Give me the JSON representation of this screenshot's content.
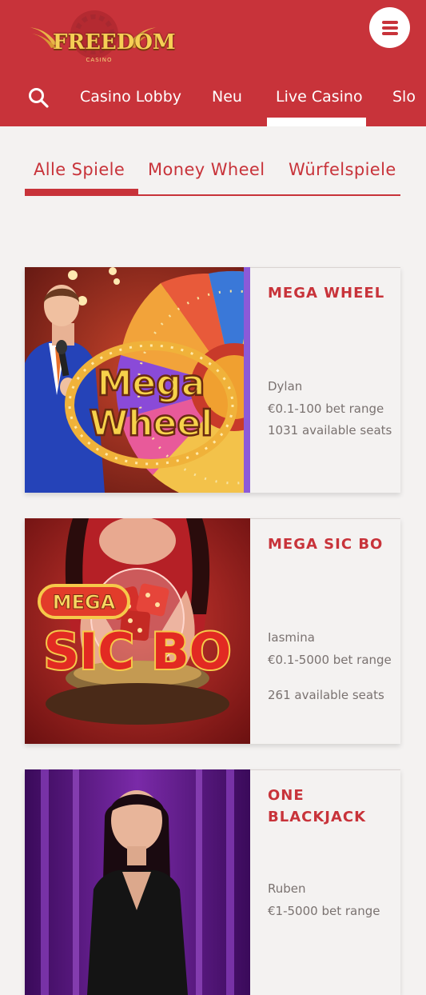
{
  "header": {
    "logo_text": "FREEDOM",
    "logo_sub": "CASINO",
    "menu_icon": "hamburger-icon"
  },
  "nav": {
    "search_icon": "search-icon",
    "items": [
      {
        "label": "Casino Lobby"
      },
      {
        "label": "Neu"
      },
      {
        "label": "Live Casino"
      },
      {
        "label": "Slo"
      }
    ],
    "active": "Live Casino"
  },
  "subtabs": {
    "items": [
      {
        "label": "Alle Spiele"
      },
      {
        "label": "Money Wheel"
      },
      {
        "label": "Würfelspiele"
      }
    ],
    "active": "Alle Spiele"
  },
  "games": [
    {
      "title": "MEGA WHEEL",
      "image_text_1": "Mega",
      "image_text_2": "Wheel",
      "dealer": "Dylan",
      "bet_range": "€0.1-100 bet range",
      "seats": "1031 available seats"
    },
    {
      "title": "MEGA SIC BO",
      "image_text_1": "MEGA",
      "image_text_2": "SIC BO",
      "dealer": "Iasmina",
      "bet_range": "€0.1-5000 bet range",
      "seats": "261 available seats"
    },
    {
      "title": "ONE BLACKJACK",
      "dealer": "Ruben",
      "bet_range": "€1-5000 bet range"
    }
  ],
  "colors": {
    "brand_red": "#c8333a",
    "background": "#f4f2f1",
    "text_muted": "#7a7270"
  }
}
